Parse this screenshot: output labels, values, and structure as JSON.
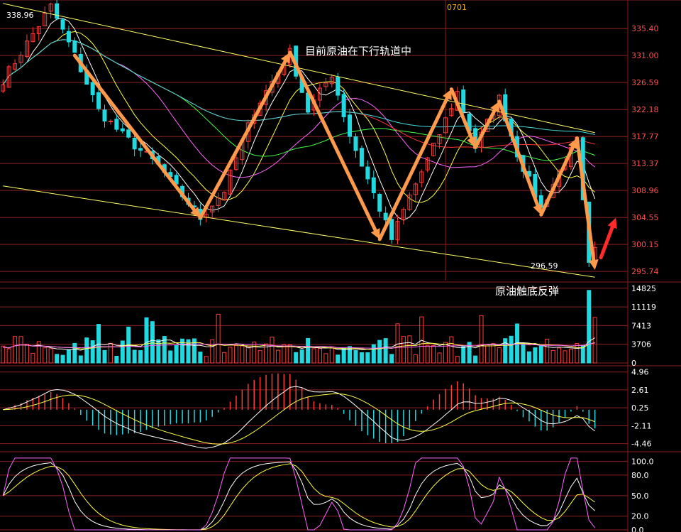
{
  "colors": {
    "background": "#000000",
    "grid": "#8c1f1f",
    "up": "#ff3b3b",
    "down": "#21d9e0",
    "channel": "#ffff66",
    "arrow": "#ff9a4a",
    "arrow_rebound": "#ff2a2a",
    "price_label": "#ff5050",
    "axis_label": "#ffffff"
  },
  "header": {
    "date_marker": "0701"
  },
  "annotations": {
    "channel_note": "目前原油在下行轨道中",
    "bottom_note": "原油触底反弹",
    "high_label": "338.96",
    "low_label": "296.59"
  },
  "chart_data": [
    {
      "type": "candlestick",
      "panel": "price",
      "y_ticks": [
        "335.40",
        "331.00",
        "326.59",
        "322.18",
        "317.77",
        "313.37",
        "308.96",
        "304.55",
        "300.15",
        "295.74"
      ],
      "ylim": [
        294.6,
        339.6
      ],
      "n": 100,
      "key_points": [
        {
          "i": 0,
          "v": 327
        },
        {
          "i": 8,
          "v": 339
        },
        {
          "i": 12,
          "v": 331
        },
        {
          "i": 16,
          "v": 322
        },
        {
          "i": 20,
          "v": 318
        },
        {
          "i": 26,
          "v": 313
        },
        {
          "i": 33,
          "v": 304.5
        },
        {
          "i": 37,
          "v": 309
        },
        {
          "i": 42,
          "v": 322
        },
        {
          "i": 48,
          "v": 331.5
        },
        {
          "i": 51,
          "v": 322
        },
        {
          "i": 55,
          "v": 328
        },
        {
          "i": 58,
          "v": 318
        },
        {
          "i": 63,
          "v": 306
        },
        {
          "i": 65,
          "v": 301
        },
        {
          "i": 68,
          "v": 308
        },
        {
          "i": 72,
          "v": 316
        },
        {
          "i": 76,
          "v": 325
        },
        {
          "i": 79,
          "v": 316
        },
        {
          "i": 83,
          "v": 324
        },
        {
          "i": 86,
          "v": 315
        },
        {
          "i": 90,
          "v": 306
        },
        {
          "i": 93,
          "v": 312
        },
        {
          "i": 96,
          "v": 317
        },
        {
          "i": 98,
          "v": 296.6
        },
        {
          "i": 99,
          "v": 299
        }
      ],
      "channel": {
        "upper": [
          [
            0,
            339.5
          ],
          [
            99,
            318.4
          ]
        ],
        "lower": [
          [
            0,
            309.7
          ],
          [
            99,
            294.8
          ]
        ]
      },
      "trend_arrows": [
        {
          "from": [
            12,
            331
          ],
          "to": [
            33,
            304.5
          ]
        },
        {
          "from": [
            33,
            304.5
          ],
          "to": [
            48,
            331.5
          ]
        },
        {
          "from": [
            48,
            331.5
          ],
          "to": [
            63,
            301
          ]
        },
        {
          "from": [
            63,
            301
          ],
          "to": [
            75,
            325.5
          ]
        },
        {
          "from": [
            75,
            325.5
          ],
          "to": [
            79,
            316
          ]
        },
        {
          "from": [
            79,
            316
          ],
          "to": [
            83,
            323.5
          ]
        },
        {
          "from": [
            83,
            323.5
          ],
          "to": [
            90,
            305
          ]
        },
        {
          "from": [
            90,
            305
          ],
          "to": [
            96,
            317.5
          ]
        },
        {
          "from": [
            96,
            317.5
          ],
          "to": [
            99,
            296
          ]
        }
      ],
      "rebound_arrow": {
        "from": [
          100,
          298
        ],
        "to": [
          102.5,
          304.5
        ]
      }
    },
    {
      "type": "bar",
      "panel": "volume",
      "y_ticks": [
        "14825",
        "11119",
        "7413",
        "3706",
        "0"
      ],
      "ylim": [
        0,
        15500
      ]
    },
    {
      "type": "bar",
      "panel": "macd",
      "y_ticks": [
        "4.96",
        "2.61",
        "0.25",
        "-2.11",
        "-4.46"
      ],
      "ylim": [
        -4.96,
        5.4
      ]
    },
    {
      "type": "line",
      "panel": "kdj",
      "y_ticks": [
        "100.0",
        "80.0",
        "50.0",
        "20.0",
        "0.0"
      ],
      "ylim": [
        0,
        110
      ]
    }
  ]
}
